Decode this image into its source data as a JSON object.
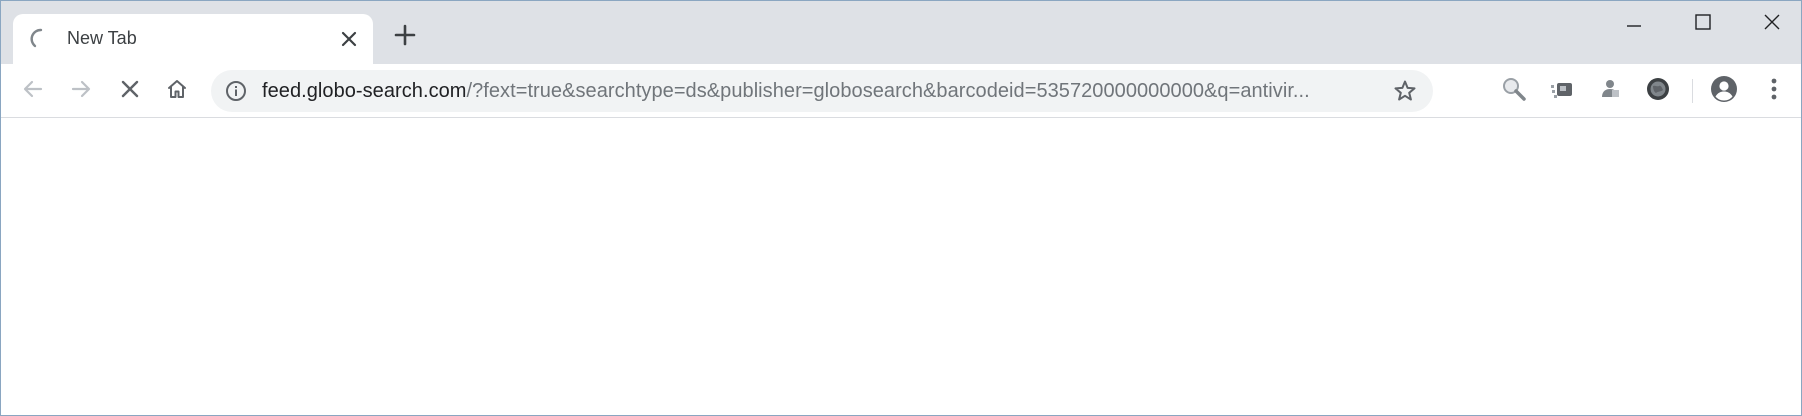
{
  "tab": {
    "title": "New Tab",
    "loading": true
  },
  "icons": {
    "spinner": "loading-spinner-icon",
    "close": "close-icon",
    "new_tab": "plus-icon",
    "minimize": "minimize-icon",
    "maximize": "maximize-icon",
    "window_close": "window-close-icon",
    "back": "back-arrow-icon",
    "forward": "forward-arrow-icon",
    "stop": "stop-icon",
    "home": "home-icon",
    "info": "info-icon",
    "bookmark": "star-icon",
    "extensions": [
      "search-extension-icon",
      "extension-icon-2",
      "extension-icon-3",
      "globe-extension-icon"
    ],
    "profile": "account-icon",
    "menu": "more-vert-icon"
  },
  "omnibox": {
    "url_host": "feed.globo-search.com",
    "url_rest": "/?fext=true&searchtype=ds&publisher=globosearch&barcodeid=535720000000000&q=antivir..."
  },
  "colors": {
    "tabstrip": "#dee1e6",
    "omnibox": "#f1f3f4",
    "icon": "#5f6368",
    "icon_disabled": "#bdc1c6",
    "text": "#202124"
  }
}
